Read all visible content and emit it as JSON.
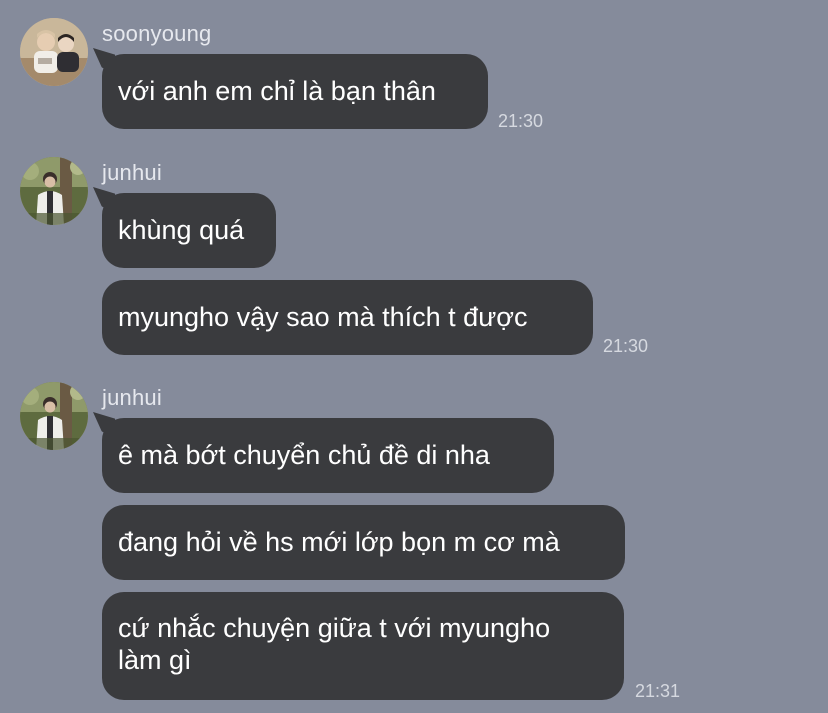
{
  "conversation": {
    "groups": [
      {
        "sender": "soonyoung",
        "avatar_icon": "user-photo-two-people-icon",
        "messages": [
          "với anh em chỉ là bạn thân"
        ],
        "time": "21:30"
      },
      {
        "sender": "junhui",
        "avatar_icon": "user-photo-person-tree-icon",
        "messages": [
          "khùng quá",
          "myungho vậy sao mà thích t được"
        ],
        "time": "21:30"
      },
      {
        "sender": "junhui",
        "avatar_icon": "user-photo-person-tree-icon",
        "messages": [
          "ê mà bớt chuyển chủ đề di nha",
          "đang hỏi về hs mới lớp bọn m cơ mà",
          "cứ nhắc chuyện giữa t với myungho\nlàm gì"
        ],
        "time": "21:31"
      }
    ]
  },
  "colors": {
    "background": "#858b9b",
    "bubble": "#3a3b3e",
    "text": "#ffffff"
  }
}
